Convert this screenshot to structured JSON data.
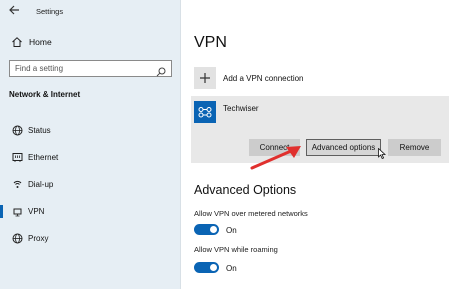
{
  "window": {
    "title": "Settings"
  },
  "sidebar": {
    "home_label": "Home",
    "search_placeholder": "Find a setting",
    "section_heading": "Network & Internet",
    "items": [
      {
        "label": "Status",
        "icon": "globe-icon"
      },
      {
        "label": "Ethernet",
        "icon": "ethernet-icon"
      },
      {
        "label": "Dial-up",
        "icon": "dial-up-icon"
      },
      {
        "label": "VPN",
        "icon": "vpn-icon",
        "selected": true
      },
      {
        "label": "Proxy",
        "icon": "proxy-globe-icon"
      }
    ]
  },
  "main": {
    "title": "VPN",
    "add_label": "Add a VPN connection",
    "connection": {
      "name": "Techwiser",
      "buttons": {
        "connect": "Connect",
        "advanced": "Advanced options",
        "remove": "Remove"
      }
    },
    "advanced": {
      "title": "Advanced Options",
      "toggles": [
        {
          "label": "Allow VPN over metered networks",
          "state": "On"
        },
        {
          "label": "Allow VPN while roaming",
          "state": "On"
        }
      ]
    }
  },
  "colors": {
    "accent": "#0a64b4",
    "sidebar_bg": "#e6eef4",
    "card_bg": "#e8e8e8",
    "annotation_arrow": "#e0302e"
  }
}
